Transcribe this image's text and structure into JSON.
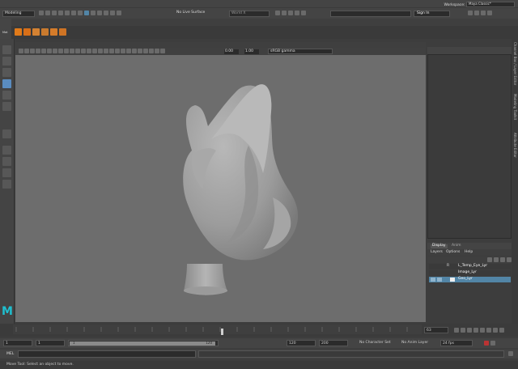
{
  "menubar": {
    "items": [
      "File",
      "Edit",
      "Create",
      "Select",
      "Modify",
      "Display",
      "Windows",
      "Mesh",
      "Edit Mesh",
      "Mesh Tools",
      "Mesh Display",
      "Curves",
      "Surfaces",
      "Deform",
      "UV",
      "Generate",
      "Cache",
      "Substance",
      "Arnold",
      "Help"
    ],
    "workspace_label": "Workspace:",
    "workspace_value": "Maya Classic*"
  },
  "statusline": {
    "mode": "Modeling",
    "live_surface": "No Live Surface",
    "symmetry": "World X",
    "signin": "Sign In"
  },
  "shelf": {
    "tabs": [
      "Curves / Surfaces",
      "Poly Modeling",
      "Sculpting",
      "Rigging",
      "Animation",
      "Rendering",
      "FX",
      "FX Caching",
      "Custom",
      "Arnold",
      "Bifrost",
      "MASH",
      "Motion Graphics",
      "XGen",
      "Custom_PolyT"
    ],
    "active_index": 14,
    "side_labels": [
      "Mat",
      "UV"
    ]
  },
  "viewport": {
    "menus": [
      "View",
      "Shading",
      "Lighting",
      "Show",
      "Renderer",
      "Panels"
    ],
    "field1": "0.00",
    "field2": "1.00",
    "colorspace": "sRGB gamma"
  },
  "channelbox": {
    "menus": [
      "Channels",
      "Edit",
      "Object",
      "Show"
    ],
    "side_tabs": [
      "Channel Box / Layer Editor",
      "Modeling Toolkit",
      "Attribute Editor"
    ]
  },
  "layers": {
    "tabs": [
      "Display",
      "Anim"
    ],
    "menus": [
      "Layers",
      "Options",
      "Help"
    ],
    "items": [
      {
        "flag": "R",
        "name": "L_Temp_Eye_Lyr",
        "selected": false
      },
      {
        "flag": "",
        "name": "Image_Lyr",
        "selected": false
      },
      {
        "flag": "",
        "name": "Geo_Lyr",
        "selected": true
      }
    ]
  },
  "timeslider": {
    "current_frame": "63"
  },
  "range": {
    "start": "1",
    "start2": "1",
    "slider_start": "1",
    "slider_end": "120",
    "end": "120",
    "end2": "200",
    "character_set": "No Character Set",
    "anim_layer": "No Anim Layer",
    "fps": "24 fps"
  },
  "mel": {
    "label": "MEL"
  },
  "help": {
    "text": "Move Tool: Select an object to move."
  },
  "maya_logo": "M"
}
